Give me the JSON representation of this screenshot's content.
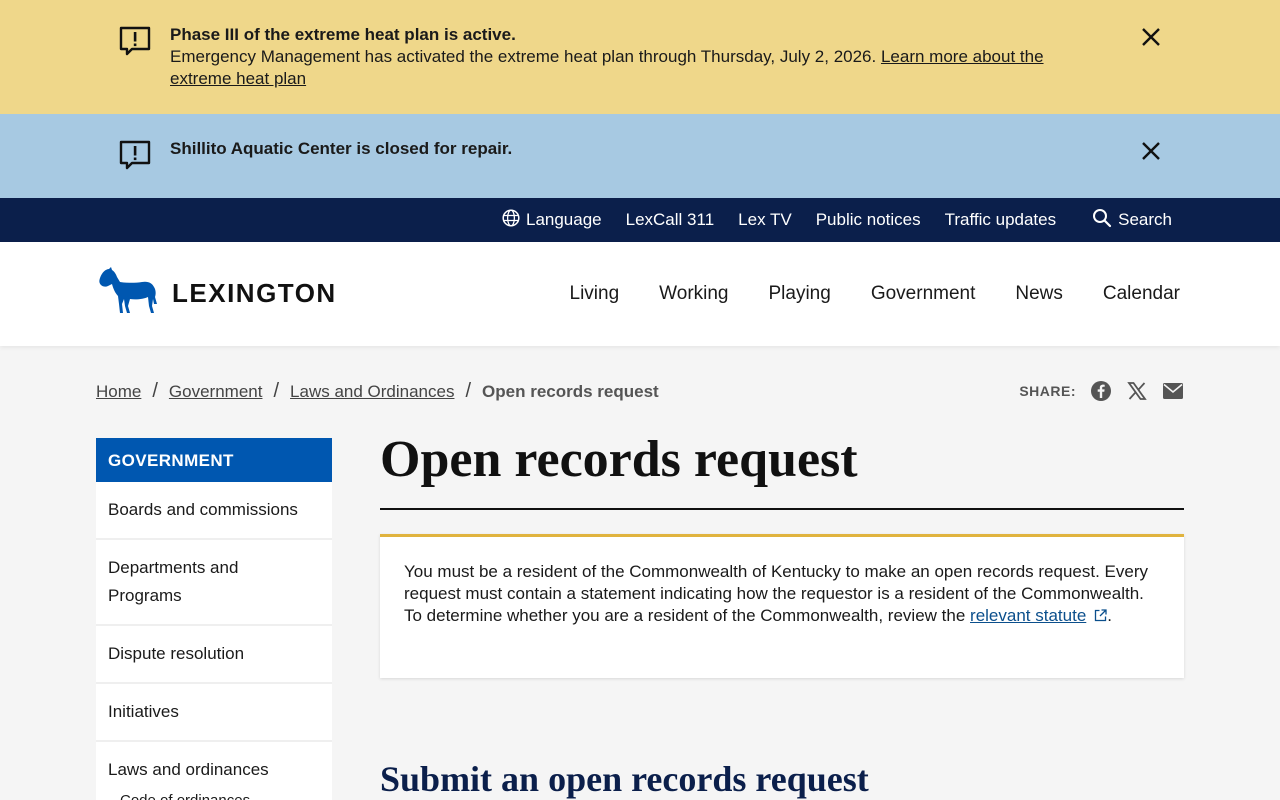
{
  "alerts": [
    {
      "title": "Phase III of the extreme heat plan is active.",
      "body": "Emergency Management has activated the extreme heat plan through Thursday, July 2, 2026.",
      "link": "Learn more about the extreme heat plan",
      "icon": "alert-icon",
      "close_icon": "close-icon",
      "color": "#efd78a"
    },
    {
      "title": "Shillito Aquatic Center is closed for repair.",
      "icon": "alert-icon",
      "close_icon": "close-icon",
      "color": "#a7c9e2"
    }
  ],
  "utility_nav": {
    "items": [
      "Language",
      "LexCall 311",
      "Lex TV",
      "Public notices",
      "Traffic updates"
    ],
    "search": "Search",
    "language_icon": "globe-icon",
    "search_icon": "search-icon",
    "color": "#0b1f4b"
  },
  "header": {
    "logo_text": "LEXINGTON",
    "logo_icon": "horse-icon",
    "nav": [
      "Living",
      "Working",
      "Playing",
      "Government",
      "News",
      "Calendar"
    ]
  },
  "breadcrumb": {
    "items": [
      "Home",
      "Government",
      "Laws and Ordinances"
    ],
    "current": "Open records request",
    "separator": "/"
  },
  "share": {
    "label": "SHARE:",
    "icons": [
      "facebook-icon",
      "x-icon",
      "email-icon"
    ]
  },
  "sidebar": {
    "heading": "GOVERNMENT",
    "items": [
      "Boards and commissions",
      "Departments and Programs",
      "Dispute resolution",
      "Initiatives",
      "Laws and ordinances"
    ],
    "subitems": [
      "Code of ordinances"
    ],
    "accent": "#0057b0"
  },
  "main": {
    "title": "Open records request",
    "notice_text": "You must be a resident of the Commonwealth of Kentucky to make an open records request. Every request must contain a statement indicating how the requestor is a resident of the Commonwealth. To determine whether you are a resident of the Commonwealth, review the",
    "notice_link": "relevant statute",
    "notice_link_icon": "external-link-icon",
    "notice_end": ".",
    "section_heading": "Submit an open records request",
    "notice_accent": "#e0b33e"
  }
}
